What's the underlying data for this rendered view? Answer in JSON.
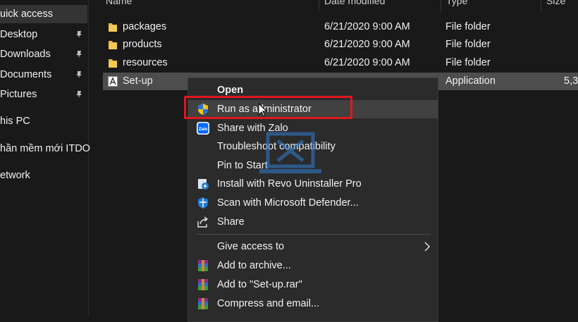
{
  "sidebar": {
    "items": [
      {
        "label": "uick access",
        "pinned": false,
        "selected": true
      },
      {
        "label": "Desktop",
        "pinned": true
      },
      {
        "label": "Downloads",
        "pinned": true
      },
      {
        "label": "Documents",
        "pinned": true
      },
      {
        "label": "Pictures",
        "pinned": true
      },
      {
        "label": "his PC",
        "pinned": false
      },
      {
        "label": "hần mềm mới ITDO",
        "pinned": false
      },
      {
        "label": "etwork",
        "pinned": false
      }
    ]
  },
  "columns": {
    "name": "Name",
    "date": "Date modified",
    "type": "Type",
    "size": "Size"
  },
  "files": [
    {
      "name": "packages",
      "date": "6/21/2020 9:00 AM",
      "type": "File folder",
      "size": "",
      "icon": "folder-icon"
    },
    {
      "name": "products",
      "date": "6/21/2020 9:00 AM",
      "type": "File folder",
      "size": "",
      "icon": "folder-icon"
    },
    {
      "name": "resources",
      "date": "6/21/2020 9:00 AM",
      "type": "File folder",
      "size": "",
      "icon": "folder-icon"
    },
    {
      "name": "Set-up",
      "date": "",
      "type": "Application",
      "size": "5,3",
      "icon": "adobe-app-icon",
      "selected": true
    }
  ],
  "context_menu": {
    "items": [
      {
        "label": "Open",
        "bold": true,
        "icon": ""
      },
      {
        "label": "Run as administrator",
        "icon": "shield-icon",
        "hover": true
      },
      {
        "label": "Share with Zalo",
        "icon": "zalo-icon"
      },
      {
        "label": "Troubleshoot compatibility",
        "icon": ""
      },
      {
        "label": "Pin to Start",
        "icon": ""
      },
      {
        "label": "Install with Revo Uninstaller Pro",
        "icon": "revo-icon"
      },
      {
        "label": "Scan with Microsoft Defender...",
        "icon": "defender-icon"
      },
      {
        "label": "Share",
        "icon": "share-icon"
      },
      {
        "label": "Give access to",
        "icon": "",
        "submenu": true
      },
      {
        "label": "Add to archive...",
        "icon": "winrar-icon"
      },
      {
        "label": "Add to \"Set-up.rar\"",
        "icon": "winrar-icon"
      },
      {
        "label": "Compress and email...",
        "icon": "winrar-icon"
      }
    ]
  },
  "colors": {
    "background": "#191919",
    "menu_background": "#2b2b2b",
    "highlight_border": "#e0161e",
    "selected_row": "#4d4d4d"
  }
}
